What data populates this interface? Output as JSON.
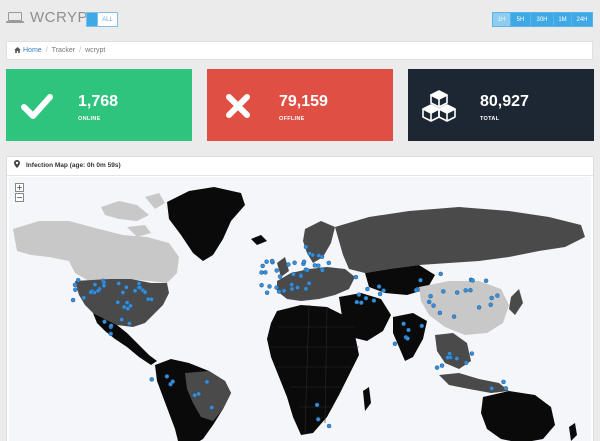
{
  "header": {
    "title": "WCRYPT",
    "scope_buttons": [
      "",
      "ALL"
    ],
    "ranges": [
      "1H",
      "5H",
      "30H",
      "1M",
      "24H"
    ]
  },
  "breadcrumb": {
    "home": "Home",
    "items": [
      "Tracker",
      "wcrypt"
    ]
  },
  "stats": {
    "online": {
      "value": "1,768",
      "label": "ONLINE",
      "color": "#2fc47e",
      "icon": "check-icon"
    },
    "offline": {
      "value": "79,159",
      "label": "OFFLINE",
      "color": "#e04f44",
      "icon": "cross-icon"
    },
    "total": {
      "value": "80,927",
      "label": "TOTAL",
      "color": "#1d2733",
      "icon": "cubes-icon"
    }
  },
  "map": {
    "title": "Infection Map (age: 0h 0m 59s)",
    "zoom_in": "+",
    "zoom_out": "−",
    "colors": {
      "ocean": "#f4f6f9",
      "dark": "#0a0a0a",
      "medium": "#4a4a4a",
      "light": "#c8c8c8",
      "dot": "#3a90d8"
    }
  }
}
